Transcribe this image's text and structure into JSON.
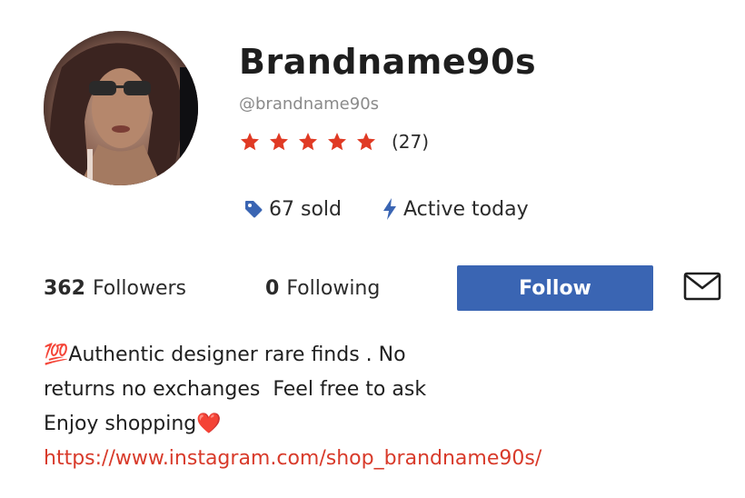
{
  "profile": {
    "display_name": "Brandname90s",
    "handle": "@brandname90s",
    "rating": {
      "stars": 5,
      "count_label": "(27)",
      "star_color": "#e03a24"
    },
    "stats": {
      "sold_label": "67 sold",
      "activity_label": "Active today"
    },
    "followers": {
      "count": "362",
      "label": "Followers"
    },
    "following": {
      "count": "0",
      "label": "Following"
    },
    "follow_button_label": "Follow",
    "message_icon": "mail-icon",
    "bio": {
      "line1_emoji": "💯",
      "line1_text": "Authentic designer rare finds . No",
      "line2": "returns no exchanges  Feel free to ask",
      "line3_text": "Enjoy shopping",
      "line3_emoji": "❤️",
      "link": "https://www.instagram.com/shop_brandname90s/"
    }
  },
  "colors": {
    "accent": "#3a65b3",
    "link": "#d83a2a",
    "star": "#e03a24",
    "muted": "#8a8a8a"
  }
}
